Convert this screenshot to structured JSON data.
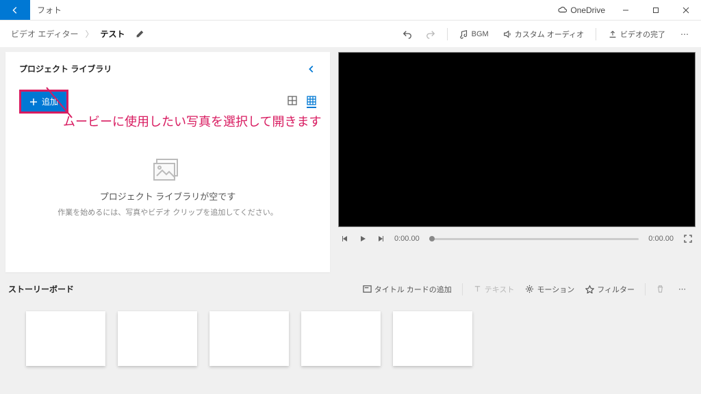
{
  "titlebar": {
    "app_name": "フォト",
    "onedrive_label": "OneDrive"
  },
  "breadcrumb": {
    "root": "ビデオ エディター",
    "current": "テスト"
  },
  "top_actions": {
    "bgm": "BGM",
    "custom_audio": "カスタム オーディオ",
    "finish_video": "ビデオの完了"
  },
  "library": {
    "title": "プロジェクト ライブラリ",
    "add_label": "追加",
    "empty_title": "プロジェクト ライブラリが空です",
    "empty_sub": "作業を始めるには、写真やビデオ クリップを追加してください。"
  },
  "annotation": {
    "text": "ムービーに使用したい写真を選択して開きます"
  },
  "player": {
    "time_start": "0:00.00",
    "time_end": "0:00.00"
  },
  "storyboard": {
    "title": "ストーリーボード",
    "add_title_card": "タイトル カードの追加",
    "text": "テキスト",
    "motion": "モーション",
    "filters": "フィルター"
  }
}
